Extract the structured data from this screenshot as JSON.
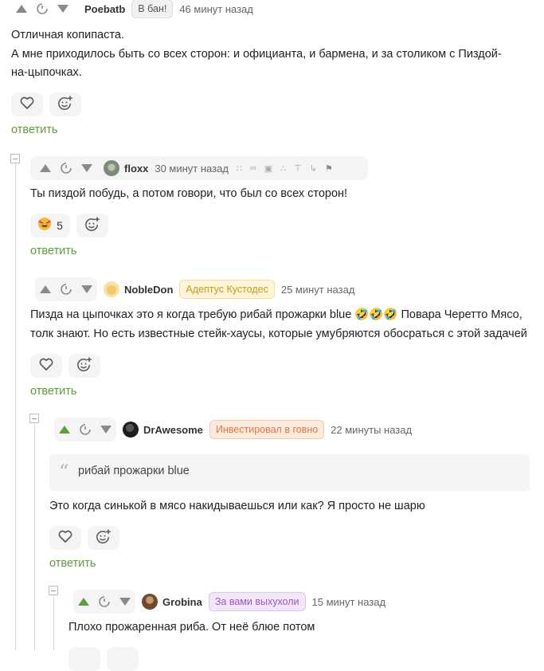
{
  "comments": [
    {
      "author": "Poebatb",
      "badge": "В бан!",
      "time": "46 минут назад",
      "text_lines": [
        "Отличная копипаста.",
        "А мне приходилось быть со всех сторон: и официанта, и бармена, и за столиком с Пиздой-",
        "на-цыпочках."
      ],
      "reply": "ответить"
    },
    {
      "author": "floxx",
      "time": "30 минут назад",
      "text_lines": [
        "Ты пиздой побудь, а потом говори, что был со всех сторон!"
      ],
      "reaction_count": "5",
      "reply": "ответить"
    },
    {
      "author": "NobleDon",
      "badge": "Адептус Кустодес",
      "time": "25 минут назад",
      "text_lines": [
        "Пизда на цыпочках это я когда требую рибай прожарки blue 🤣🤣🤣 Повара Черетто Мясо,",
        "толк знают. Но есть известные стейк-хаусы, которые умубряются обосраться с этой задачей"
      ],
      "reply": "ответить"
    },
    {
      "author": "DrAwesome",
      "badge": "Инвестировал в говно",
      "time": "22 минуты назад",
      "quote": "рибай прожарки blue",
      "text_lines": [
        "Это когда синькой в мясо накидываешься или как? Я просто не шарю"
      ],
      "reply": "ответить"
    },
    {
      "author": "Grobina",
      "badge": "За вами выхухоли",
      "time": "15 минут назад",
      "text_lines": [
        "Плохо прожаренная риба. От неё блюе потом"
      ]
    }
  ],
  "colors": {
    "reply_green": "#5c9d3b",
    "upvote_active": "#5c9d3b",
    "badge_custodes_bg": "#fff4d6",
    "badge_custodes_fg": "#c79a1a",
    "badge_invest_bg": "#fdeadf",
    "badge_invest_fg": "#e0783e",
    "badge_vyhuhol_bg": "#f3e6fb",
    "badge_vyhuhol_fg": "#9b57c4"
  },
  "icons": [
    "upvote-icon",
    "downvote-icon",
    "clock-icon",
    "heart-icon",
    "add-reaction-icon",
    "quote-icon",
    "collapse-icon"
  ]
}
